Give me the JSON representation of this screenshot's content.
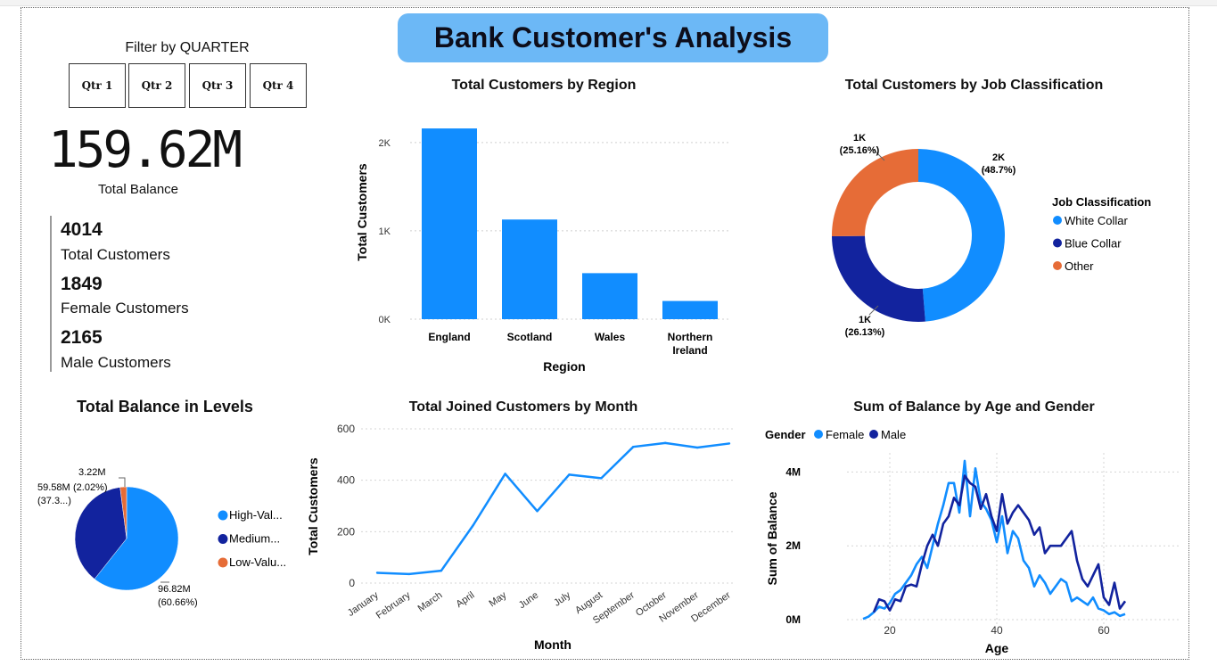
{
  "header": {
    "title": "Bank Customer's Analysis"
  },
  "filter": {
    "title": "Filter by QUARTER",
    "buttons": [
      "Qtr 1",
      "Qtr 2",
      "Qtr 3",
      "Qtr 4"
    ]
  },
  "kpis": {
    "total_balance": {
      "value": "159.62M",
      "label": "Total Balance"
    },
    "total_customers": {
      "value": "4014",
      "label": "Total Customers"
    },
    "female_customers": {
      "value": "1849",
      "label": "Female Customers"
    },
    "male_customers": {
      "value": "2165",
      "label": "Male Customers"
    }
  },
  "colors": {
    "primary_blue": "#118dff",
    "dark_blue": "#12239e",
    "orange": "#e66c37",
    "title_pill": "#6cb8f6"
  },
  "chart_data": [
    {
      "id": "region",
      "type": "bar",
      "title": "Total Customers by Region",
      "xlabel": "Region",
      "ylabel": "Total Customers",
      "categories": [
        "England",
        "Scotland",
        "Wales",
        "Northern Ireland"
      ],
      "values": [
        2159,
        1128,
        521,
        206
      ],
      "ylim": [
        0,
        2200
      ],
      "yticks": [
        0,
        1000,
        2000
      ],
      "ytick_labels": [
        "0K",
        "1K",
        "2K"
      ],
      "grid": true
    },
    {
      "id": "job",
      "type": "pie",
      "donut": true,
      "title": "Total Customers by Job Classification",
      "legend_title": "Job Classification",
      "legend_position": "right",
      "labels": [
        "White Collar",
        "Blue Collar",
        "Other"
      ],
      "values": [
        1955,
        1049,
        1010
      ],
      "percents": [
        "48.7%",
        "26.13%",
        "25.16%"
      ],
      "data_labels": [
        "2K",
        "1K",
        "1K"
      ],
      "colors": [
        "#118dff",
        "#12239e",
        "#e66c37"
      ]
    },
    {
      "id": "levels",
      "type": "pie",
      "title": "Total Balance in Levels",
      "legend_position": "right",
      "labels": [
        "High-Value",
        "Medium-Value",
        "Low-Value"
      ],
      "legend_labels": [
        "High-Val...",
        "Medium...",
        "Low-Valu..."
      ],
      "values": [
        96.82,
        59.58,
        3.22
      ],
      "value_labels": [
        "96.82M",
        "59.58M",
        "3.22M"
      ],
      "percents": [
        "(60.66%)",
        "(37.3...)",
        "(2.02%)"
      ],
      "colors": [
        "#118dff",
        "#12239e",
        "#e66c37"
      ]
    },
    {
      "id": "monthly",
      "type": "line",
      "title": "Total Joined Customers by Month",
      "xlabel": "Month",
      "ylabel": "Total Customers",
      "categories": [
        "January",
        "February",
        "March",
        "April",
        "May",
        "June",
        "July",
        "August",
        "September",
        "October",
        "November",
        "December"
      ],
      "values": [
        40,
        35,
        48,
        225,
        425,
        280,
        422,
        408,
        530,
        545,
        527,
        543
      ],
      "ylim": [
        0,
        600
      ],
      "yticks": [
        0,
        200,
        400,
        600
      ],
      "grid": true
    },
    {
      "id": "age",
      "type": "line",
      "title": "Sum of Balance by Age and Gender",
      "xlabel": "Age",
      "ylabel": "Sum of Balance",
      "legend_title": "Gender",
      "legend_position": "top-left",
      "xlim": [
        12,
        67
      ],
      "xticks": [
        20,
        40,
        60
      ],
      "ylim": [
        0,
        5000000
      ],
      "yticks": [
        0,
        2000000,
        4000000
      ],
      "ytick_labels": [
        "0M",
        "2M",
        "4M"
      ],
      "grid": true,
      "series": [
        {
          "name": "Female",
          "color": "#118dff",
          "x": [
            15,
            16,
            17,
            18,
            19,
            20,
            21,
            22,
            23,
            24,
            25,
            26,
            27,
            28,
            29,
            30,
            31,
            32,
            33,
            34,
            35,
            36,
            37,
            38,
            39,
            40,
            41,
            42,
            43,
            44,
            45,
            46,
            47,
            48,
            49,
            50,
            51,
            52,
            53,
            54,
            55,
            56,
            57,
            58,
            59,
            60,
            61,
            62,
            63,
            64
          ],
          "y": [
            20000,
            80000,
            200000,
            350000,
            300000,
            450000,
            700000,
            800000,
            1000000,
            1200000,
            1500000,
            1700000,
            1400000,
            2000000,
            2600000,
            3100000,
            3700000,
            3700000,
            2900000,
            4300000,
            2800000,
            4100000,
            3200000,
            3000000,
            2700000,
            2100000,
            2800000,
            1800000,
            2400000,
            2200000,
            1600000,
            1400000,
            900000,
            1200000,
            1000000,
            700000,
            900000,
            1100000,
            1000000,
            500000,
            600000,
            500000,
            400000,
            600000,
            300000,
            250000,
            150000,
            200000,
            100000,
            150000
          ]
        },
        {
          "name": "Male",
          "color": "#12239e",
          "x": [
            17,
            18,
            19,
            20,
            21,
            22,
            23,
            24,
            25,
            26,
            27,
            28,
            29,
            30,
            31,
            32,
            33,
            34,
            35,
            36,
            37,
            38,
            39,
            40,
            41,
            42,
            43,
            44,
            45,
            46,
            47,
            48,
            49,
            50,
            51,
            52,
            53,
            54,
            55,
            56,
            57,
            58,
            59,
            60,
            61,
            62,
            63,
            64
          ],
          "y": [
            200000,
            550000,
            500000,
            250000,
            550000,
            500000,
            900000,
            950000,
            900000,
            1500000,
            2000000,
            2300000,
            2000000,
            2600000,
            2800000,
            3300000,
            3100000,
            3900000,
            3700000,
            3600000,
            3000000,
            3400000,
            2800000,
            2400000,
            3400000,
            2600000,
            2900000,
            3100000,
            2900000,
            2700000,
            2300000,
            2500000,
            1800000,
            2000000,
            2000000,
            2000000,
            2200000,
            2400000,
            1600000,
            1100000,
            900000,
            1200000,
            1500000,
            600000,
            400000,
            1000000,
            300000,
            500000
          ]
        }
      ]
    }
  ]
}
